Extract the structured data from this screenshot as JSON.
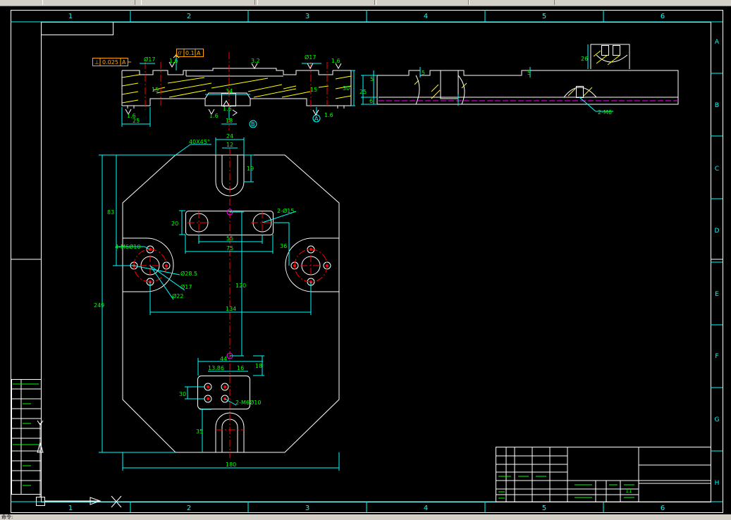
{
  "drawing": {
    "column_labels": [
      "1",
      "2",
      "3",
      "4",
      "5",
      "6"
    ],
    "row_labels": [
      "A",
      "B",
      "C",
      "D",
      "E",
      "F",
      "G",
      "H"
    ],
    "tolerances": {
      "perpendicularity": {
        "symbol": "⊥",
        "value": "0.025",
        "datum": "A"
      },
      "parallelism": {
        "symbol": "//",
        "value": "0.1",
        "datum": "A"
      }
    },
    "datum_labels": {
      "a": "A",
      "b": "B"
    },
    "section_dims": {
      "d17_left": "Ø17",
      "d17_right": "Ø17",
      "r16_left": "1.6",
      "r16_right": "1.6",
      "r32": "3.2",
      "d30": "30",
      "d25": "25",
      "d34": "34",
      "d18": "18",
      "r16a": "1.6",
      "r16b": "1.6",
      "r16c": "1.6",
      "r16d": "1.6",
      "h15a": "15",
      "h15b": "15"
    },
    "side_dims": {
      "d5a": "5",
      "d5b": "5",
      "d5c": "5",
      "d25": "25",
      "d6": "6",
      "d26": "26",
      "m6": "2-M6"
    },
    "plan_dims": {
      "chamfer": "40X45°",
      "d24": "24",
      "d12": "12",
      "d19": "19",
      "d83": "83",
      "d249": "249",
      "d20": "20",
      "d55": "55",
      "d75": "75",
      "d36": "36",
      "d2_15": "2-Ø15",
      "d4m6": "4-M6Ø10",
      "d285": "Ø28.5",
      "d17": "Ø17",
      "d22": "Ø22",
      "d120": "120",
      "d134": "134",
      "d44": "44",
      "d1386": "13.86",
      "d16": "16",
      "d18": "18",
      "d30": "30",
      "d2m6": "2-M6Ø10",
      "d35": "35",
      "d180": "180"
    },
    "title_block": {
      "cell_a": "11"
    }
  },
  "status": {
    "text": "命令:"
  },
  "colors": {
    "background": "#000000",
    "frame": "#ffffff",
    "dim": "#00ffff",
    "text_dim": "#00ff00",
    "center": "#ff0000",
    "hidden": "#ff00ff",
    "tol": "#ffa500",
    "hatch": "#ffff00"
  }
}
